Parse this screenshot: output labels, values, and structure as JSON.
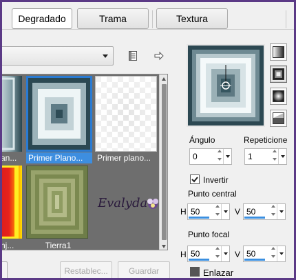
{
  "tabs": [
    "Degradado",
    "Trama",
    "Textura"
  ],
  "active_tab": "Degradado",
  "gradient_list": [
    {
      "caption": "...an...",
      "selected": false
    },
    {
      "caption": "Primer Plano...",
      "selected": true
    },
    {
      "caption": "Primer plano...",
      "selected": false
    },
    {
      "caption": "...nj...",
      "selected": false
    },
    {
      "caption": "Tierra1",
      "selected": false
    },
    {
      "caption": "",
      "selected": false
    }
  ],
  "watermark": "Evalyda",
  "buttons": {
    "reset": "Restablec...",
    "save": "Guardar"
  },
  "angle": {
    "label": "Ángulo",
    "value": "0"
  },
  "repeats": {
    "label": "Repeticione",
    "value": "1"
  },
  "invert": {
    "label": "Invertir",
    "checked": true
  },
  "center_point": {
    "label": "Punto central",
    "h_label": "H",
    "h_value": "50",
    "v_label": "V",
    "v_value": "50"
  },
  "focal_point": {
    "label": "Punto focal",
    "h_label": "H",
    "h_value": "50",
    "v_label": "V",
    "v_value": "50"
  },
  "link": {
    "label": "Enlazar",
    "checked": false
  },
  "icons": {
    "dropdown": "chevron-down-icon",
    "list-view": "list-icon",
    "export": "arrow-right-icon",
    "style-linear": "linear-gradient-icon",
    "style-rectangular": "rectangular-gradient-icon",
    "style-sunburst": "sunburst-gradient-icon",
    "style-radial": "radial-gradient-icon"
  },
  "colors": {
    "selection": "#3d8ee0",
    "accent": "#2a7bd3",
    "window_frame": "#5b3a86"
  }
}
